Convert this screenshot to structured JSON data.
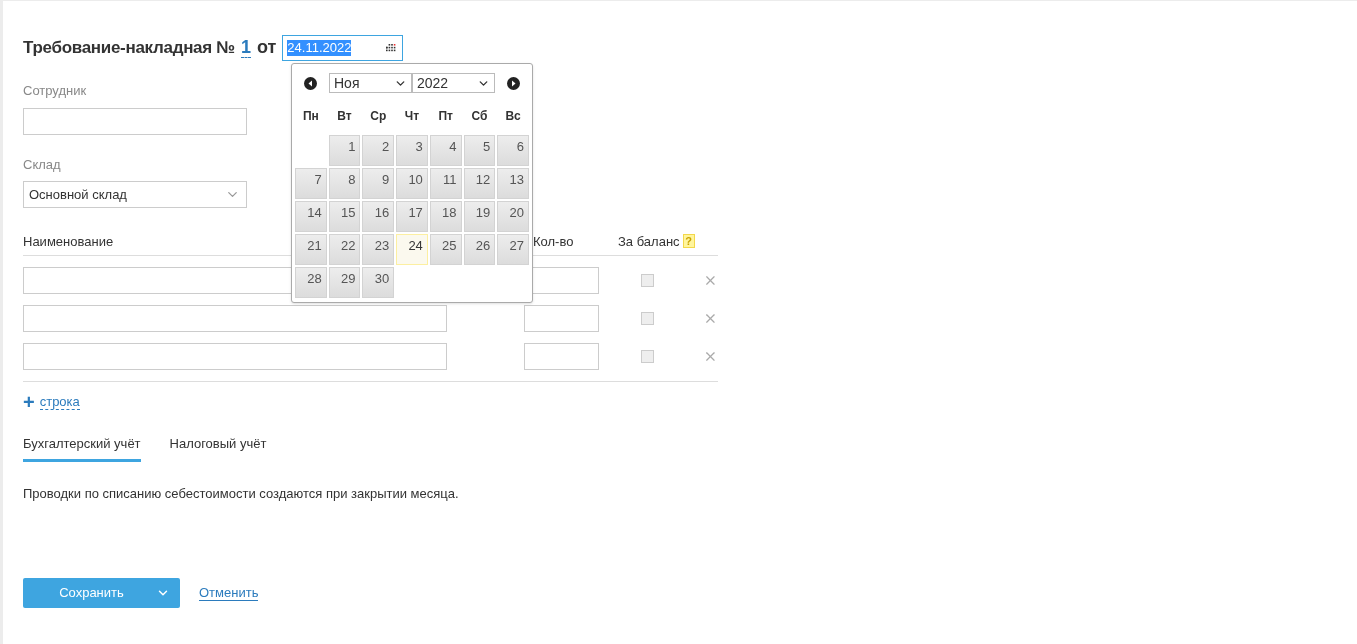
{
  "title": {
    "text": "Требование-накладная №",
    "number": "1",
    "from": "от",
    "date": "24.11.2022"
  },
  "employee": {
    "label": "Сотрудник"
  },
  "warehouse": {
    "label": "Склад",
    "value": "Основной склад"
  },
  "table": {
    "columns": [
      "Наименование",
      "Кол-во",
      "За баланс"
    ],
    "help": "?",
    "rows": [
      {
        "off_balance": false
      },
      {
        "off_balance": false
      },
      {
        "off_balance": false
      }
    ]
  },
  "add_row": {
    "icon": "+",
    "label": "строка"
  },
  "tabs": [
    {
      "label": "Бухгалтерский учёт",
      "selected": true
    },
    {
      "label": "Налоговый учёт",
      "selected": false
    }
  ],
  "note": "Проводки по списанию себестоимости создаются при закрытии месяца.",
  "buttons": {
    "save": "Сохранить",
    "cancel": "Отменить"
  },
  "calendar": {
    "month": "Ноя",
    "year": "2022",
    "weekdays": [
      "Пн",
      "Вт",
      "Ср",
      "Чт",
      "Пт",
      "Сб",
      "Вс"
    ],
    "weeks": [
      [
        {
          "day": "1",
          "selected": false
        },
        {
          "day": "2",
          "selected": false
        },
        {
          "day": "3",
          "selected": false
        },
        {
          "day": "4",
          "selected": false
        },
        {
          "day": "5",
          "selected": false
        },
        {
          "day": "6",
          "selected": false
        }
      ],
      [
        {
          "day": "7",
          "selected": false
        },
        {
          "day": "8",
          "selected": false
        },
        {
          "day": "9",
          "selected": false
        },
        {
          "day": "10",
          "selected": false
        },
        {
          "day": "11",
          "selected": false
        },
        {
          "day": "12",
          "selected": false
        },
        {
          "day": "13",
          "selected": false
        }
      ],
      [
        {
          "day": "14",
          "selected": false
        },
        {
          "day": "15",
          "selected": false
        },
        {
          "day": "16",
          "selected": false
        },
        {
          "day": "17",
          "selected": false
        },
        {
          "day": "18",
          "selected": false
        },
        {
          "day": "19",
          "selected": false
        },
        {
          "day": "20",
          "selected": false
        }
      ],
      [
        {
          "day": "21",
          "selected": false
        },
        {
          "day": "22",
          "selected": false
        },
        {
          "day": "23",
          "selected": false
        },
        {
          "day": "24",
          "selected": true
        },
        {
          "day": "25",
          "selected": false
        },
        {
          "day": "26",
          "selected": false
        },
        {
          "day": "27",
          "selected": false
        }
      ],
      [
        {
          "day": "28",
          "selected": false
        },
        {
          "day": "29",
          "selected": false
        },
        {
          "day": "30",
          "selected": false
        }
      ]
    ]
  }
}
